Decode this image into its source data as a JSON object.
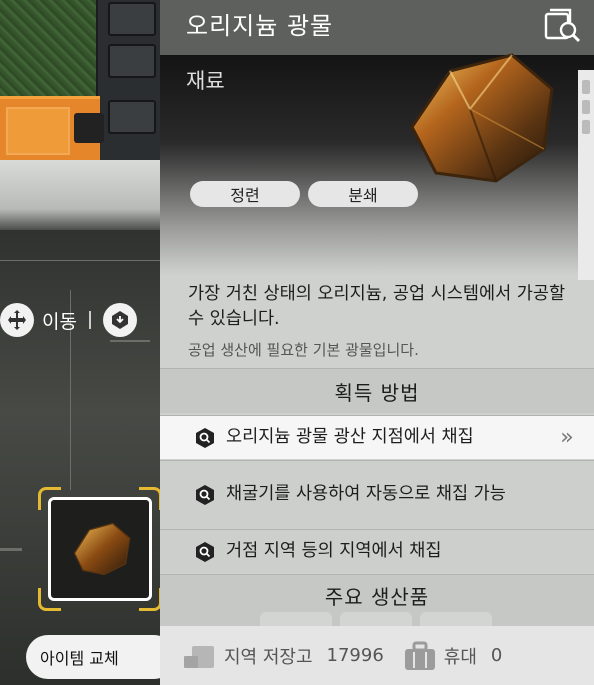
{
  "scene": {
    "move_label": "이동",
    "swap_button_label": "아이템 교체"
  },
  "panel": {
    "title": "오리지늄 광물",
    "category": "재료",
    "tags": [
      "정련",
      "분쇄"
    ],
    "description": "가장 거친 상태의 오리지늄, 공업 시스템에서 가공할 수 있습니다.",
    "subtext": "공업 생산에 필요한 기본 광물입니다.",
    "acquire_heading": "획득 방법",
    "acquire_methods": [
      "오리지늄 광물 광산 지점에서 채집",
      "채굴기를 사용하여 자동으로 채집 가능",
      "거점 지역 등의 지역에서 채집"
    ],
    "products_heading": "주요 생산품",
    "footer": {
      "region_storage_label": "지역 저장고",
      "region_storage_value": "17996",
      "carry_label": "휴대",
      "carry_value": "0"
    }
  },
  "colors": {
    "accent_orange": "#e6862a",
    "frame_gold": "#e6b933",
    "header_gray": "#5d605d",
    "active_row": "#f6f6f6"
  },
  "icons": [
    "move-icon",
    "interact-icon",
    "search-book-icon",
    "magnifier-icon",
    "double-chevron-icon",
    "storage-box-icon",
    "backpack-icon",
    "swap-icon"
  ]
}
